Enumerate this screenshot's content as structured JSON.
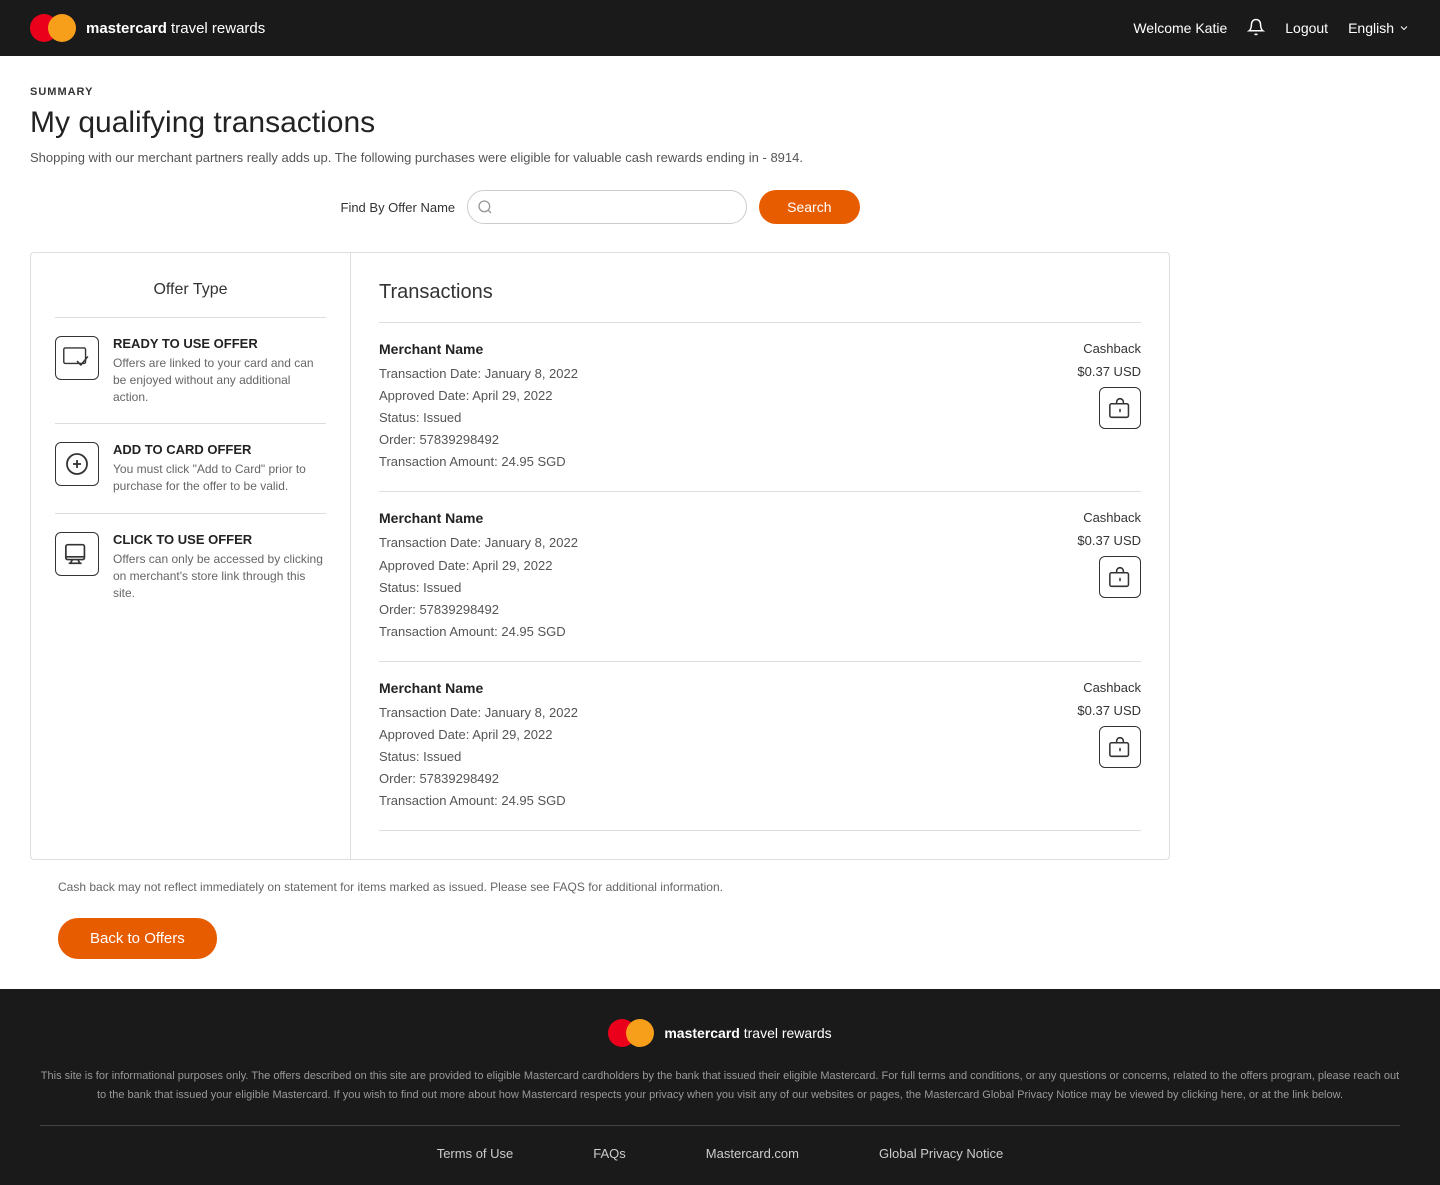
{
  "header": {
    "brand_name": "mastercard",
    "brand_suffix": " travel rewards",
    "welcome_text": "Welcome Katie",
    "logout_label": "Logout",
    "language_label": "English"
  },
  "page": {
    "summary_label": "SUMMARY",
    "title": "My qualifying transactions",
    "description": "Shopping with our merchant partners really adds up. The following purchases were eligible for valuable cash rewards ending in - 8914."
  },
  "search": {
    "label": "Find By Offer Name",
    "placeholder": "",
    "button_label": "Search"
  },
  "offer_type": {
    "panel_title": "Offer Type",
    "items": [
      {
        "title": "READY TO USE OFFER",
        "description": "Offers are linked to your card and can be enjoyed without any additional action."
      },
      {
        "title": "ADD TO CARD OFFER",
        "description": "You must click \"Add to Card\" prior to purchase for the offer to be valid."
      },
      {
        "title": "CLICK TO USE OFFER",
        "description": "Offers can only be accessed by clicking on merchant's store link through this site."
      }
    ]
  },
  "transactions": {
    "panel_title": "Transactions",
    "rows": [
      {
        "merchant": "Merchant Name",
        "transaction_date": "Transaction Date: January 8, 2022",
        "approved_date": "Approved Date: April 29, 2022",
        "status": "Status: Issued",
        "order": "Order: 57839298492",
        "amount": "Transaction Amount: 24.95 SGD",
        "cashback_label": "Cashback",
        "cashback_amount": "$0.37 USD"
      },
      {
        "merchant": "Merchant Name",
        "transaction_date": "Transaction Date: January 8, 2022",
        "approved_date": "Approved Date: April 29, 2022",
        "status": "Status: Issued",
        "order": "Order: 57839298492",
        "amount": "Transaction Amount: 24.95 SGD",
        "cashback_label": "Cashback",
        "cashback_amount": "$0.37 USD"
      },
      {
        "merchant": "Merchant Name",
        "transaction_date": "Transaction Date: January 8, 2022",
        "approved_date": "Approved Date: April 29, 2022",
        "status": "Status: Issued",
        "order": "Order: 57839298492",
        "amount": "Transaction Amount: 24.95 SGD",
        "cashback_label": "Cashback",
        "cashback_amount": "$0.37 USD"
      }
    ],
    "cashback_note": "Cash back may not reflect immediately on statement for items marked as issued. Please see FAQS for additional information.",
    "back_button_label": "Back to Offers"
  },
  "footer": {
    "brand_name": "mastercard",
    "brand_suffix": " travel rewards",
    "disclaimer": "This site is for informational purposes only. The offers described on this site are provided to eligible Mastercard cardholders by the bank that issued their eligible Mastercard. For full terms and conditions, or any questions or concerns, related to the offers program, please reach out to the bank that issued your eligible Mastercard. If you wish to find out more about how Mastercard respects your privacy when you visit any of our websites or pages, the Mastercard Global Privacy Notice may be viewed by clicking here, or at the link below.",
    "links": [
      {
        "label": "Terms of Use"
      },
      {
        "label": "FAQs"
      },
      {
        "label": "Mastercard.com"
      },
      {
        "label": "Global Privacy Notice"
      }
    ]
  }
}
